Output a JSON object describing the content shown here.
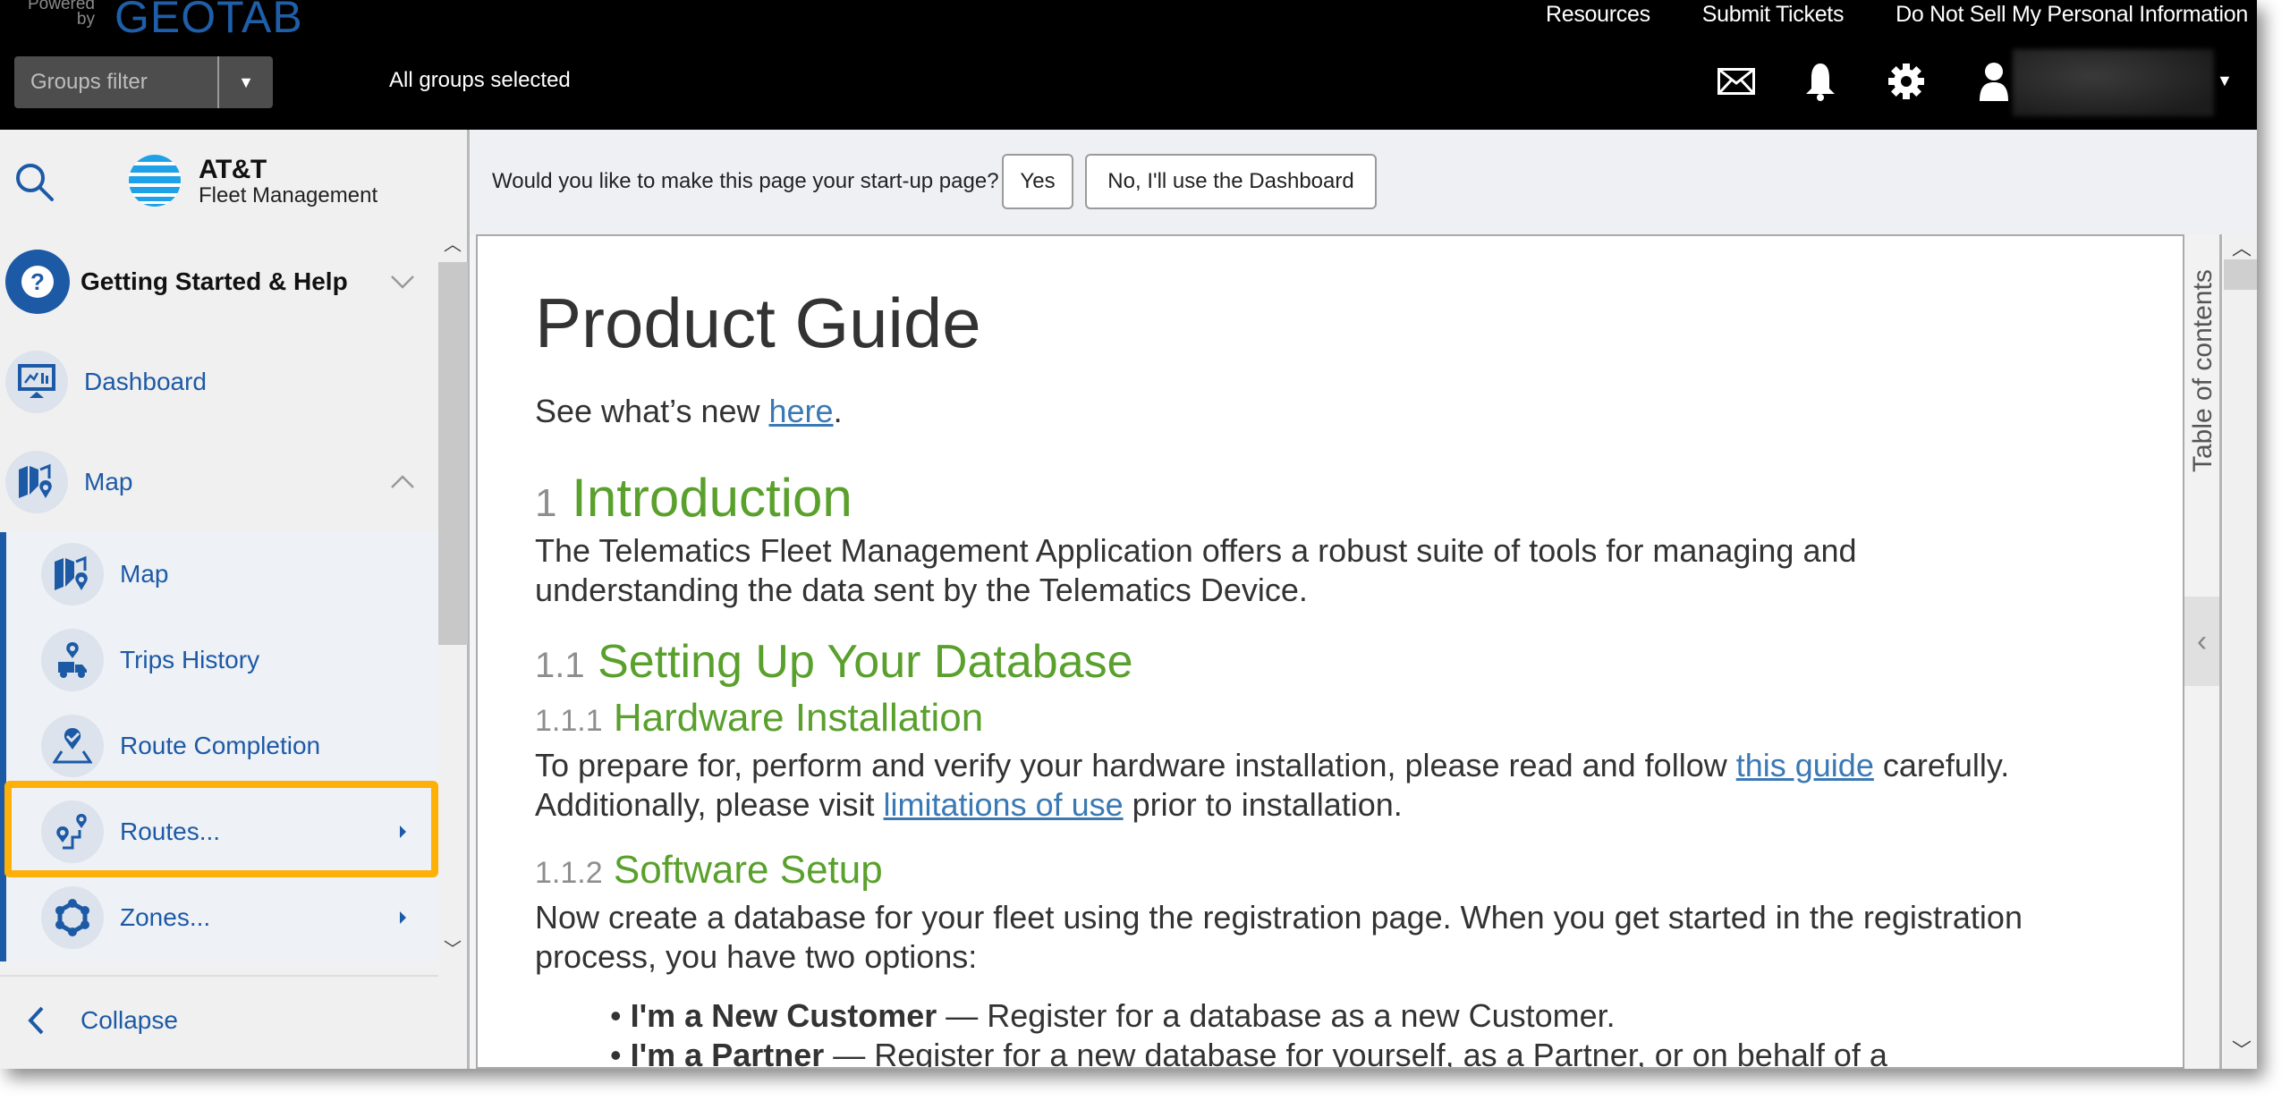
{
  "header": {
    "powered_by": "Powered by",
    "brand": "GEOTAB",
    "links": [
      "Resources",
      "Submit Tickets",
      "Do Not Sell My Personal Information"
    ],
    "groups_filter_placeholder": "Groups filter",
    "groups_status": "All groups selected",
    "icons": [
      "mail-icon",
      "bell-icon",
      "gear-icon",
      "user-icon"
    ]
  },
  "sidebar": {
    "brand_line1": "AT&T",
    "brand_line2": "Fleet Management",
    "items": [
      {
        "label": "Getting Started & Help",
        "icon": "help-icon",
        "state": "collapsed"
      },
      {
        "label": "Dashboard",
        "icon": "dashboard-icon"
      },
      {
        "label": "Map",
        "icon": "map-icon",
        "state": "expanded"
      }
    ],
    "subitems": [
      {
        "label": "Map",
        "icon": "map-icon"
      },
      {
        "label": "Trips History",
        "icon": "trips-history-icon"
      },
      {
        "label": "Route Completion",
        "icon": "route-completion-icon"
      },
      {
        "label": "Routes...",
        "icon": "routes-icon",
        "has_submenu": true,
        "highlighted": true
      },
      {
        "label": "Zones...",
        "icon": "zones-icon",
        "has_submenu": true
      }
    ],
    "collapse_label": "Collapse"
  },
  "prompt": {
    "question": "Would you like to make this page your start-up page?",
    "yes_label": "Yes",
    "no_label": "No, I'll use the Dashboard"
  },
  "doc": {
    "title": "Product Guide",
    "whats_new_prefix": "See what’s new ",
    "whats_new_link": "here",
    "whats_new_suffix": ".",
    "s1_num": "1",
    "s1_title": "Introduction",
    "s1_body": "The Telematics Fleet Management Application offers a robust suite of tools for managing and understanding the data sent by the Telematics Device.",
    "s11_num": "1.1",
    "s11_title": "Setting Up Your Database",
    "s111_num": "1.1.1",
    "s111_title": "Hardware Installation",
    "s111_body_a": "To prepare for, perform and verify your hardware installation, please read and follow ",
    "s111_link1": "this guide",
    "s111_body_b": " carefully. Additionally, please visit ",
    "s111_link2": "limitations of use",
    "s111_body_c": " prior to installation.",
    "s112_num": "1.1.2",
    "s112_title": "Software Setup",
    "s112_body": "Now create a database for your fleet using the registration page. When you get started in the registration process, you have two options:",
    "bullets": [
      {
        "bold": "I'm a New Customer",
        "text": " — Register for a database as a new Customer."
      },
      {
        "bold": "I'm a Partner",
        "text": " — Register for a new database for yourself, as a Partner, or on behalf of a"
      }
    ]
  },
  "toc": {
    "label": "Table of contents"
  },
  "colors": {
    "accent": "#1d5aa6",
    "heading": "#5aa02c",
    "highlight": "#fcb008",
    "link": "#3a79b4"
  }
}
